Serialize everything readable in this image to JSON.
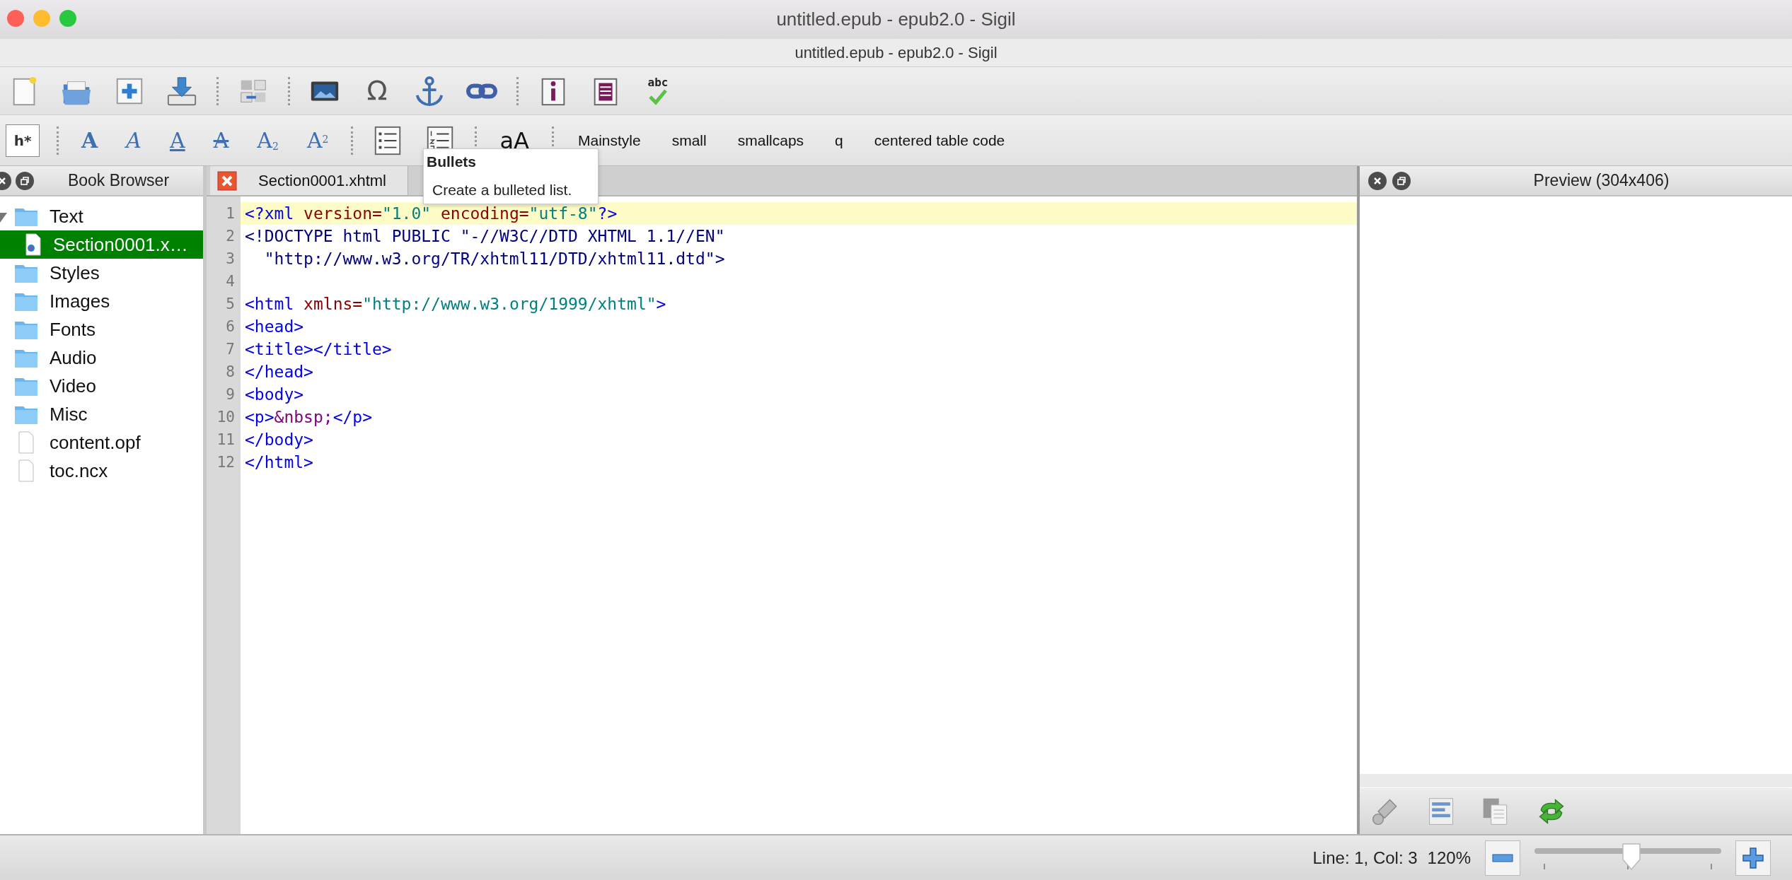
{
  "window": {
    "title": "untitled.epub - epub2.0 - Sigil",
    "subtitle": "untitled.epub - epub2.0 - Sigil"
  },
  "main_toolbar": [
    {
      "kind": "new"
    },
    {
      "kind": "open"
    },
    {
      "kind": "add"
    },
    {
      "kind": "save"
    },
    {
      "kind": "separator"
    },
    {
      "kind": "split"
    },
    {
      "kind": "separator"
    },
    {
      "kind": "image"
    },
    {
      "kind": "special",
      "text": "Ω"
    },
    {
      "kind": "anchor"
    },
    {
      "kind": "link"
    },
    {
      "kind": "separator"
    },
    {
      "kind": "metadata"
    },
    {
      "kind": "toc"
    },
    {
      "kind": "spellcheck",
      "text": "abc"
    }
  ],
  "format_toolbar": [
    {
      "kind": "heading",
      "text": "h*"
    },
    {
      "kind": "separator"
    },
    {
      "kind": "bold",
      "text": "A"
    },
    {
      "kind": "italic",
      "text": "A"
    },
    {
      "kind": "underline",
      "text": "A"
    },
    {
      "kind": "strike",
      "text": "A"
    },
    {
      "kind": "subscript",
      "text": "A$_{2}$"
    },
    {
      "kind": "superscript",
      "text": "A$^{2}$"
    },
    {
      "kind": "separator"
    },
    {
      "kind": "bullets"
    },
    {
      "kind": "numbers"
    },
    {
      "kind": "separator"
    },
    {
      "kind": "case",
      "text": "aA"
    },
    {
      "kind": "separator"
    },
    {
      "kind": "style",
      "text": "Mainstyle"
    },
    {
      "kind": "style",
      "text": "small"
    },
    {
      "kind": "style",
      "text": "smallcaps"
    },
    {
      "kind": "style",
      "text": "q"
    },
    {
      "kind": "style",
      "text": "centered table code"
    }
  ],
  "book_browser": {
    "title": "Book Browser",
    "items": [
      {
        "label": "Text",
        "kind": "folder",
        "expanded": true,
        "selected": false,
        "children": [
          {
            "label": "Section0001.x…",
            "kind": "html",
            "selected": true
          }
        ]
      },
      {
        "label": "Styles",
        "kind": "folder",
        "selected": false
      },
      {
        "label": "Images",
        "kind": "folder",
        "selected": false
      },
      {
        "label": "Fonts",
        "kind": "folder",
        "selected": false
      },
      {
        "label": "Audio",
        "kind": "folder",
        "selected": false
      },
      {
        "label": "Video",
        "kind": "folder",
        "selected": false
      },
      {
        "label": "Misc",
        "kind": "folder",
        "selected": false
      },
      {
        "label": "content.opf",
        "kind": "file",
        "selected": false
      },
      {
        "label": "toc.ncx",
        "kind": "file",
        "selected": false
      }
    ]
  },
  "editor": {
    "tab": {
      "label": "Section0001.xhtml"
    },
    "lines": [
      {
        "number": "1",
        "current": true,
        "tokens": [
          {
            "text": "<?xml",
            "kind": "tag"
          },
          {
            "text": " version=",
            "kind": "attr"
          },
          {
            "text": "\"1.0\"",
            "kind": "value"
          },
          {
            "text": " encoding=",
            "kind": "attr"
          },
          {
            "text": "\"utf-8\"",
            "kind": "value"
          },
          {
            "text": "?>",
            "kind": "tag"
          }
        ]
      },
      {
        "number": "2",
        "current": false,
        "tokens": [
          {
            "text": "<!DOCTYPE html PUBLIC \"-//W3C//DTD XHTML 1.1//EN\"",
            "kind": "doctype"
          }
        ]
      },
      {
        "number": "3",
        "current": false,
        "tokens": [
          {
            "text": "  \"http://www.w3.org/TR/xhtml11/DTD/xhtml11.dtd\">",
            "kind": "doctype"
          }
        ]
      },
      {
        "number": "4",
        "current": false
      },
      {
        "number": "5",
        "current": false,
        "tokens": [
          {
            "text": "<html",
            "kind": "tag"
          },
          {
            "text": " xmlns=",
            "kind": "attr"
          },
          {
            "text": "\"http://www.w3.org/1999/xhtml\"",
            "kind": "value"
          },
          {
            "text": ">",
            "kind": "tag"
          }
        ]
      },
      {
        "number": "6",
        "current": false,
        "tokens": [
          {
            "text": "<head>",
            "kind": "tag"
          }
        ]
      },
      {
        "number": "7",
        "current": false,
        "tokens": [
          {
            "text": "<title></title>",
            "kind": "tag"
          }
        ]
      },
      {
        "number": "8",
        "current": false,
        "tokens": [
          {
            "text": "</head>",
            "kind": "tag"
          }
        ]
      },
      {
        "number": "9",
        "current": false,
        "tokens": [
          {
            "text": "<body>",
            "kind": "tag"
          }
        ]
      },
      {
        "number": "10",
        "current": false,
        "tokens": [
          {
            "text": "<p>",
            "kind": "tag"
          },
          {
            "text": "&nbsp;",
            "kind": "entity"
          },
          {
            "text": "</p>",
            "kind": "tag"
          }
        ]
      },
      {
        "number": "11",
        "current": false,
        "tokens": [
          {
            "text": "</body>",
            "kind": "tag"
          }
        ]
      },
      {
        "number": "12",
        "current": false,
        "tokens": [
          {
            "text": "</html>",
            "kind": "tag"
          }
        ]
      }
    ]
  },
  "tooltip": {
    "title": "Bullets",
    "text": "Create a bulleted list."
  },
  "preview": {
    "title": "Preview (304x406)",
    "tools": [
      {
        "kind": "inspect"
      },
      {
        "kind": "format"
      },
      {
        "kind": "copy"
      },
      {
        "kind": "refresh"
      }
    ]
  },
  "status_bar": {
    "position": "Line: 1, Col: 3",
    "zoom": "120%",
    "zoom_slider": {
      "level": 0.52
    }
  }
}
